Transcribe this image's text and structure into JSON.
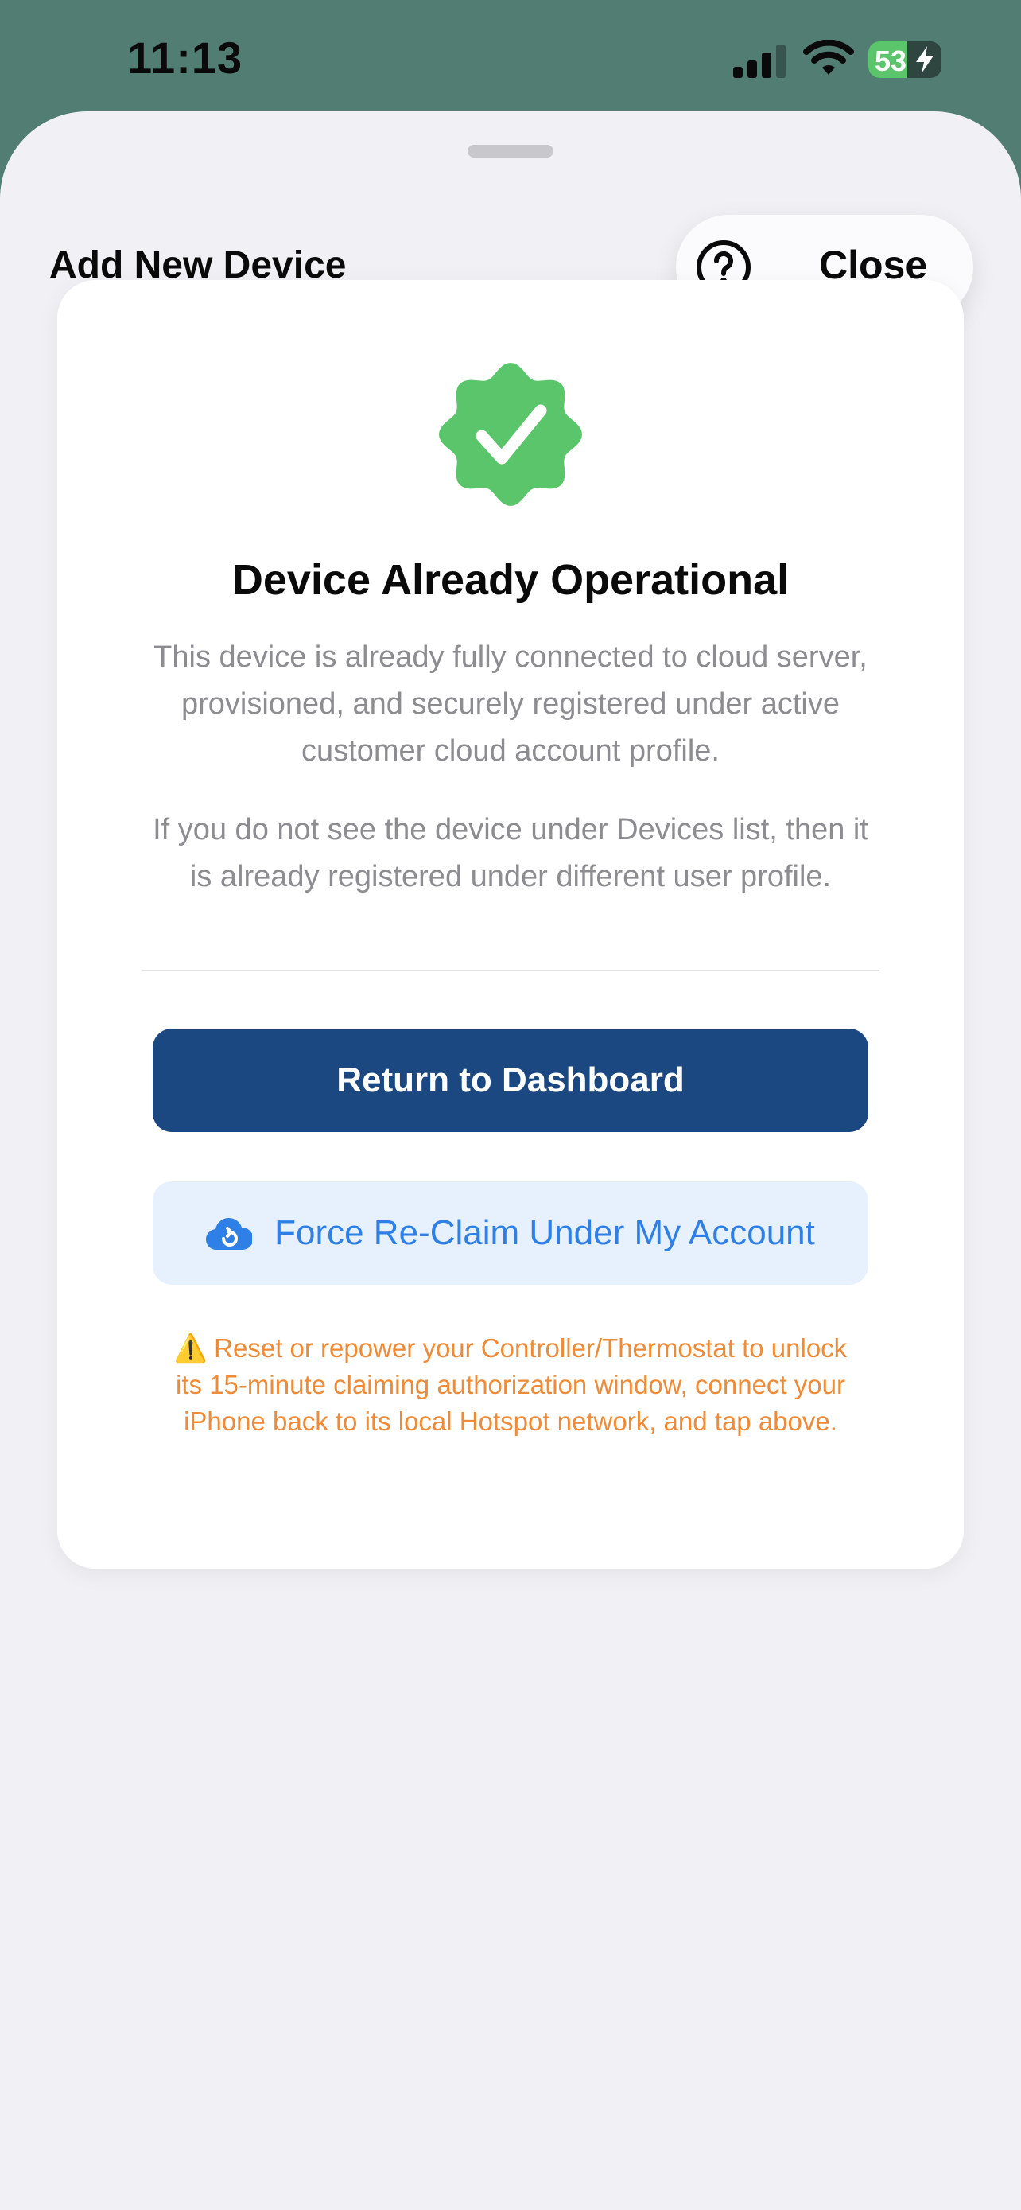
{
  "status_bar": {
    "time": "11:13",
    "battery_level": "53",
    "battery_percent": 0.53,
    "signal_icon": "cellular-signal-icon",
    "wifi_icon": "wifi-icon",
    "charging_icon": "bolt-icon",
    "battery_color": "#5ac56a"
  },
  "header": {
    "title": "Add New Device",
    "help_icon": "question-circle-icon",
    "close_label": "Close"
  },
  "card": {
    "status_icon": "verified-badge-icon",
    "status_icon_color": "#5ac56a",
    "title": "Device Already Operational",
    "description_1": "This device is already fully connected to cloud server, provisioned, and securely registered under active customer cloud account profile.",
    "description_2": "If you do not see the device under Devices list, then it is already registered under different user profile.",
    "primary_button_label": "Return to Dashboard",
    "primary_color": "#1c4882",
    "secondary_button_icon": "cloud-refresh-icon",
    "secondary_button_label": "Force Re-Claim Under My Account",
    "accent_color": "#2f80e6",
    "warning_icon": "⚠️",
    "warning_text": "Reset or repower your Controller/Thermostat to unlock its 15-minute claiming authorization window, connect your iPhone back to its local Hotspot network, and tap above.",
    "warning_color": "#ef8a36"
  }
}
